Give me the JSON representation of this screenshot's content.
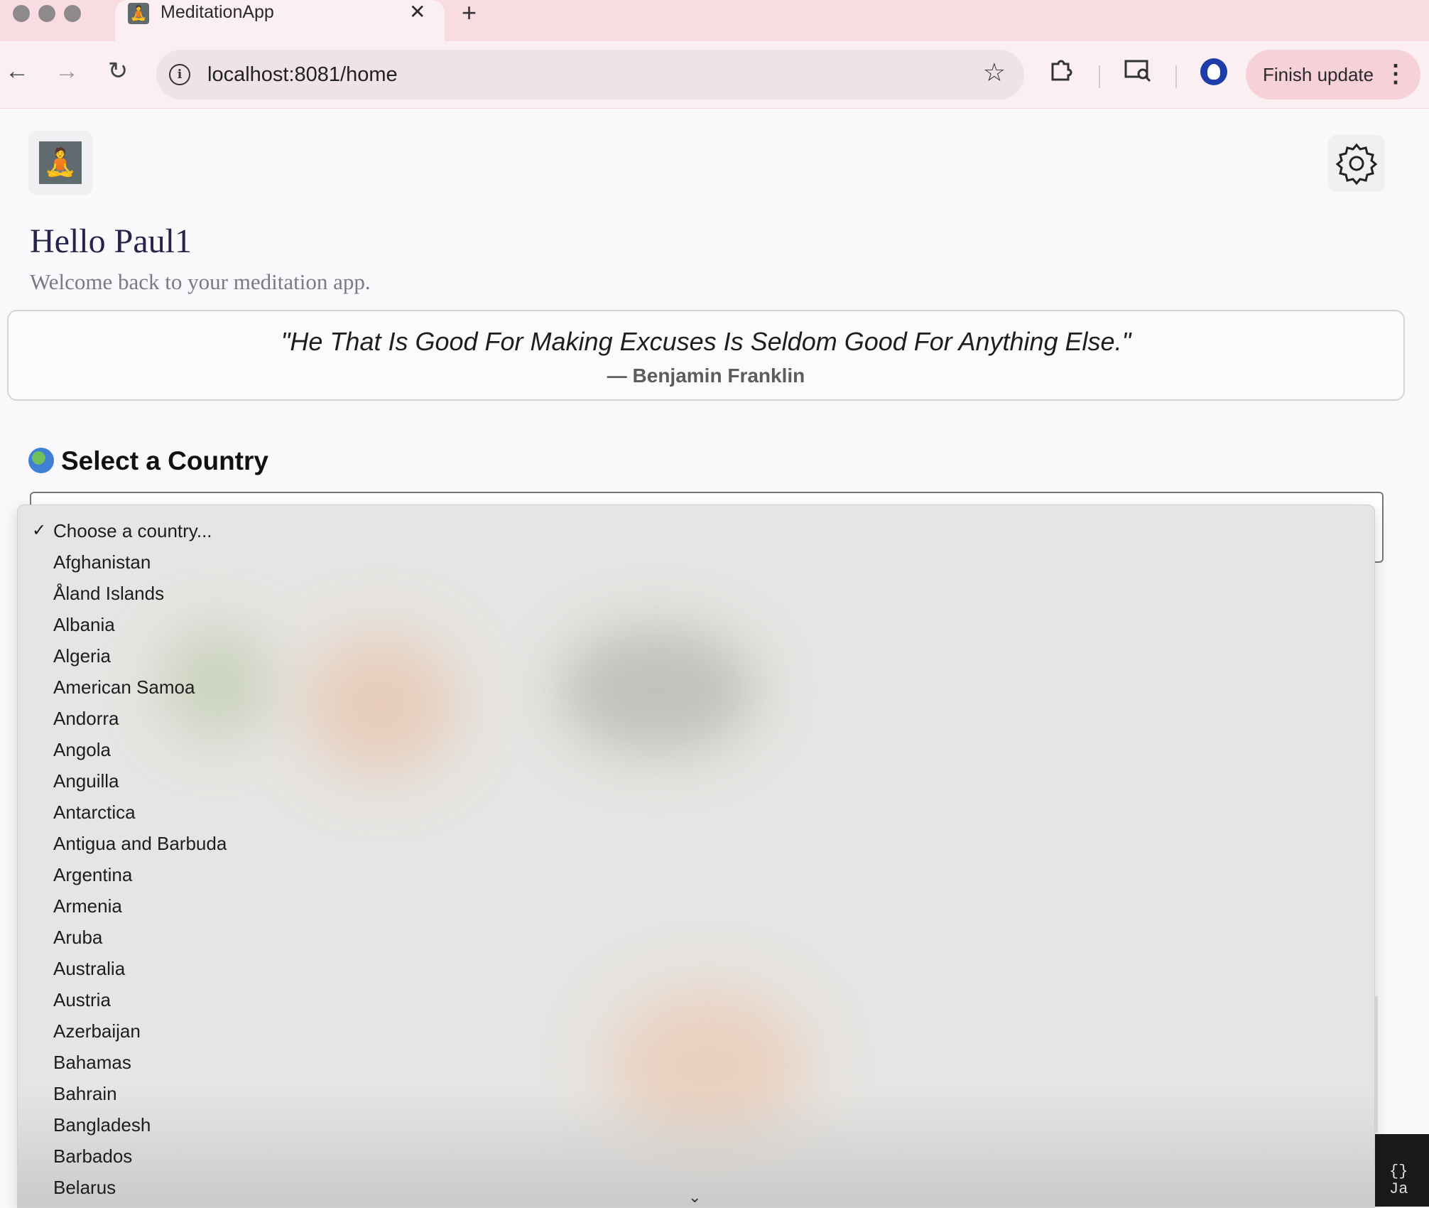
{
  "browser": {
    "tab_title": "MeditationApp",
    "tab_close": "✕",
    "new_tab": "+",
    "url": "localhost:8081/home",
    "finish_update": "Finish update"
  },
  "app": {
    "greeting": "Hello Paul1",
    "welcome": "Welcome back to your meditation app.",
    "quote": "\"He That Is Good For Making Excuses Is Seldom Good For Anything Else.\"",
    "quote_author": "— Benjamin Franklin",
    "section_title": "Select a Country"
  },
  "dropdown": {
    "selected": "Choose a country...",
    "options": [
      "Afghanistan",
      "Åland Islands",
      "Albania",
      "Algeria",
      "American Samoa",
      "Andorra",
      "Angola",
      "Anguilla",
      "Antarctica",
      "Antigua and Barbuda",
      "Argentina",
      "Armenia",
      "Aruba",
      "Australia",
      "Austria",
      "Azerbaijan",
      "Bahamas",
      "Bahrain",
      "Bangladesh",
      "Barbados",
      "Belarus"
    ]
  },
  "background": {
    "code_braces": "{} Ja"
  },
  "icons": {
    "back": "back-arrow-icon",
    "forward": "forward-arrow-icon",
    "reload": "reload-icon",
    "info": "info-icon",
    "star": "bookmark-star-icon",
    "extensions": "extensions-icon",
    "cast": "cast-search-icon",
    "profile": "profile-icon",
    "menu": "more-vert-icon",
    "logo": "meditation-figure-icon",
    "settings": "gear-icon",
    "globe": "globe-icon",
    "check": "checkmark-icon",
    "scroll": "chevron-down-icon"
  }
}
